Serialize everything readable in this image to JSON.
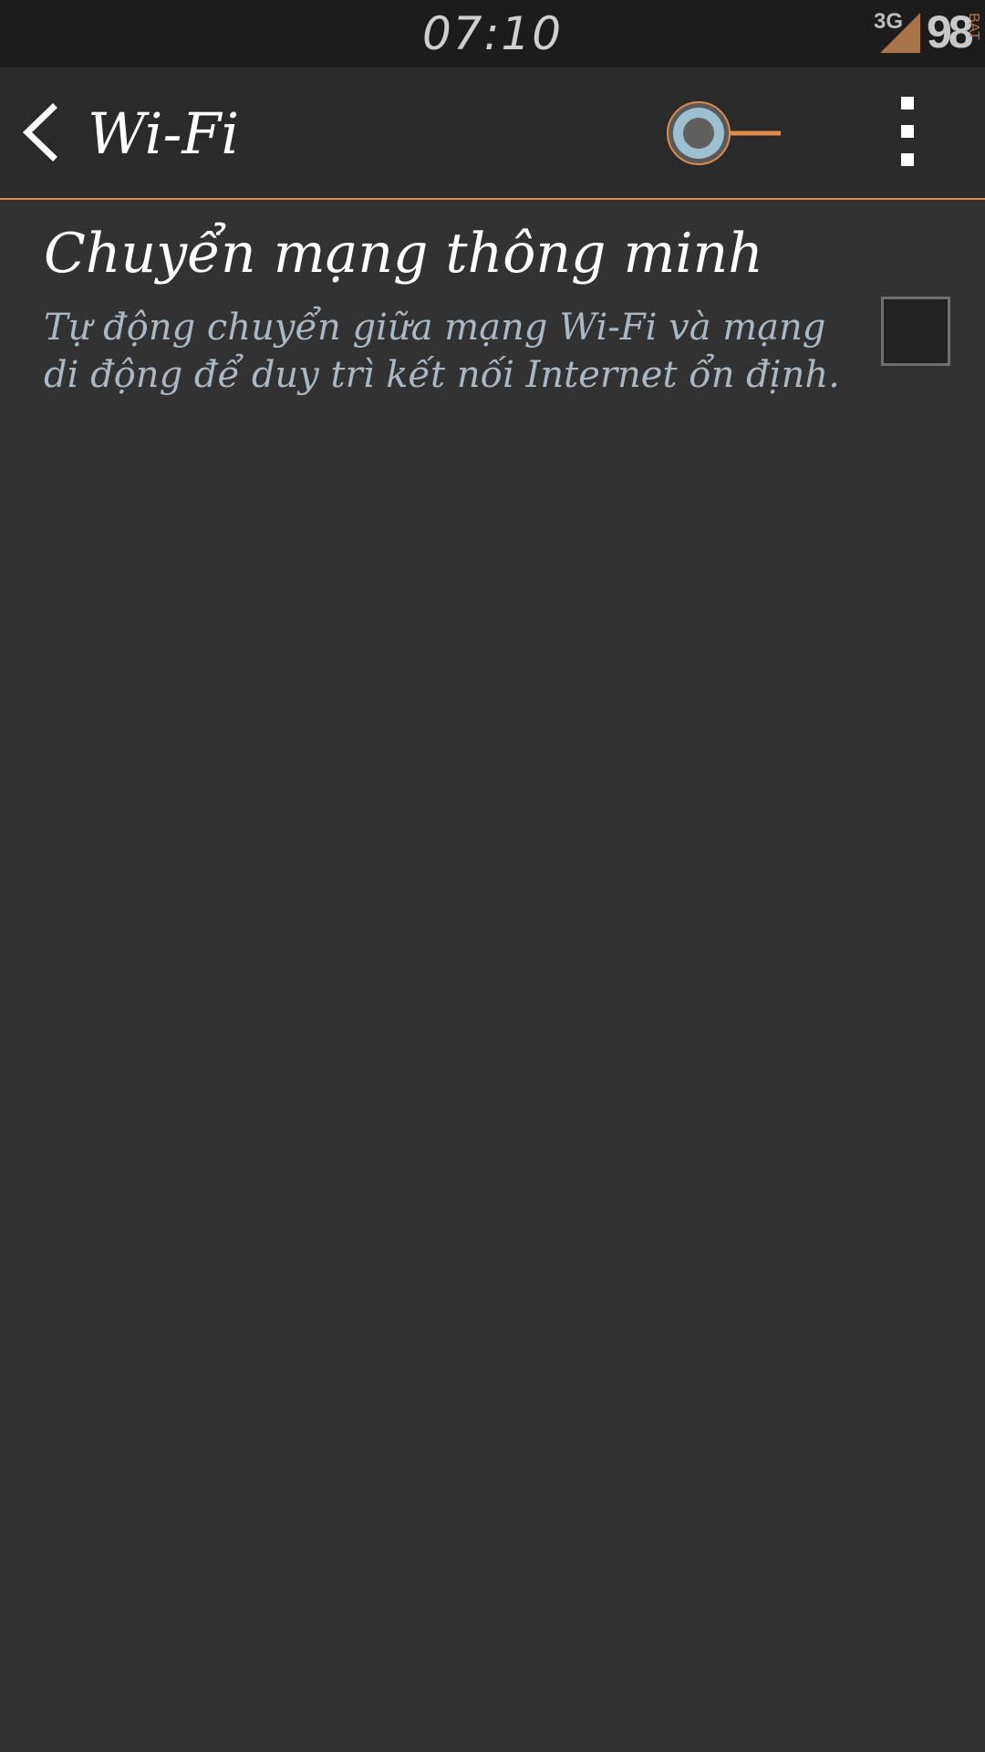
{
  "status_bar": {
    "time": "07:10",
    "network": "3G",
    "battery_level": "98",
    "battery_label": "BAT"
  },
  "action_bar": {
    "title": "Wi-Fi",
    "wifi_toggle_state": "on",
    "accent_color": "#e08a4a"
  },
  "setting": {
    "title": "Chuyển mạng thông minh",
    "summary": "Tự động chuyển giữa mạng Wi-Fi và mạng di động để duy trì kết nối Internet ổn định.",
    "checked": false
  },
  "icons": [
    "back-arrow-icon",
    "signal-icon",
    "wifi-toggle-switch",
    "overflow-menu-icon"
  ]
}
